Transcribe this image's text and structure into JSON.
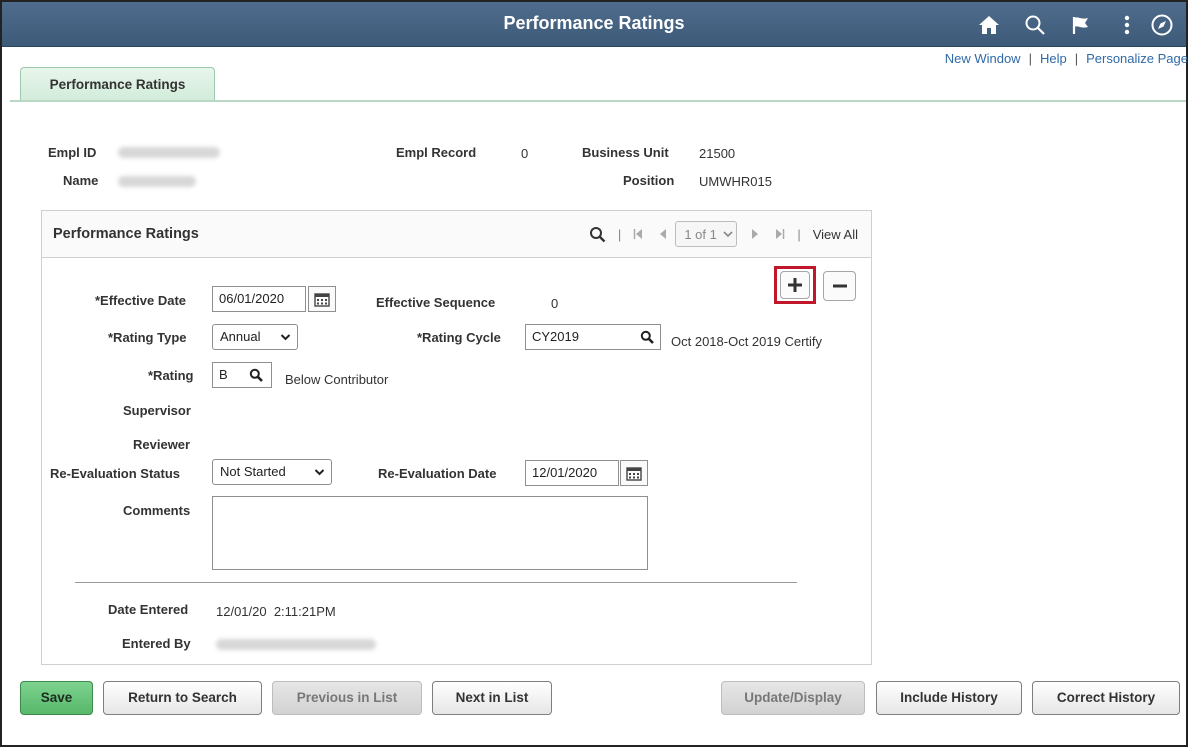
{
  "banner": {
    "title": "Performance Ratings",
    "icons": [
      "home-icon",
      "search-icon",
      "flag-icon",
      "more-vertical-icon",
      "navbar-compass-icon"
    ]
  },
  "links": {
    "new_window": "New Window",
    "help": "Help",
    "personalize": "Personalize Page",
    "separator": "|"
  },
  "tab": {
    "label": "Performance Ratings"
  },
  "employee": {
    "empl_id_label": "Empl ID",
    "name_label": "Name",
    "empl_record_label": "Empl Record",
    "empl_record_value": "0",
    "business_unit_label": "Business Unit",
    "business_unit_value": "21500",
    "position_label": "Position",
    "position_value": "UMWHR015"
  },
  "group": {
    "title": "Performance Ratings",
    "separator": "|",
    "row_count": "1 of 1",
    "view_all": "View All"
  },
  "form": {
    "effective_date_label": "*Effective Date",
    "effective_date_value": "06/01/2020",
    "effective_sequence_label": "Effective Sequence",
    "effective_sequence_value": "0",
    "rating_type_label": "*Rating Type",
    "rating_type_value": "Annual",
    "rating_cycle_label": "*Rating Cycle",
    "rating_cycle_value": "CY2019",
    "rating_cycle_desc": "Oct 2018-Oct 2019 Certify",
    "rating_label": "*Rating",
    "rating_value": "B",
    "rating_desc": "Below Contributor",
    "supervisor_label": "Supervisor",
    "reviewer_label": "Reviewer",
    "reeval_status_label": "Re-Evaluation Status",
    "reeval_status_value": "Not Started",
    "reeval_date_label": "Re-Evaluation Date",
    "reeval_date_value": "12/01/2020",
    "comments_label": "Comments",
    "comments_value": "",
    "date_entered_label": "Date Entered",
    "date_entered_value": "12/01/20  2:11:21PM",
    "entered_by_label": "Entered By"
  },
  "buttons": {
    "save": "Save",
    "return_to_search": "Return to Search",
    "previous_in_list": "Previous in List",
    "next_in_list": "Next in List",
    "update_display": "Update/Display",
    "include_history": "Include History",
    "correct_history": "Correct History"
  },
  "colors": {
    "banner": "#4a6686",
    "link": "#2e6aa8",
    "tab": "#d2ecdb",
    "save_button": "#57b86b",
    "highlight": "#c0172b"
  }
}
